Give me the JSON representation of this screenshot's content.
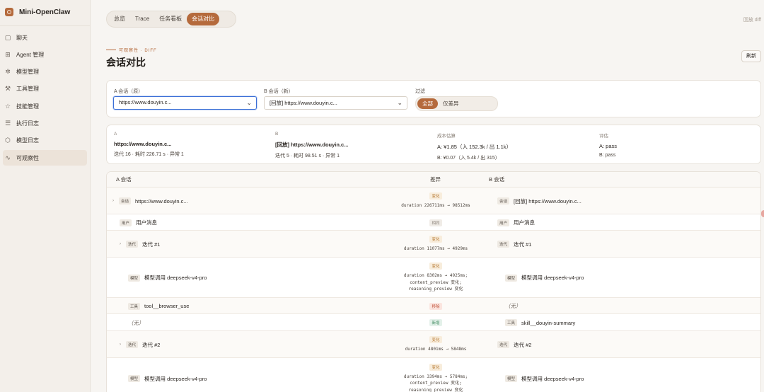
{
  "app": {
    "name": "Mini-OpenClaw",
    "logo_icon": "shield-logo-icon"
  },
  "sidebar": {
    "items": [
      {
        "label": "聊天",
        "icon": "chat-icon",
        "glyph": "▢"
      },
      {
        "label": "Agent 管理",
        "icon": "grid-icon",
        "glyph": "⊞"
      },
      {
        "label": "模型管理",
        "icon": "sparkle-icon",
        "glyph": "✲"
      },
      {
        "label": "工具管理",
        "icon": "wrench-icon",
        "glyph": "⚒"
      },
      {
        "label": "技能管理",
        "icon": "star-icon",
        "glyph": "☆"
      },
      {
        "label": "执行日志",
        "icon": "list-icon",
        "glyph": "☰"
      },
      {
        "label": "模型日志",
        "icon": "cube-icon",
        "glyph": "⬡"
      },
      {
        "label": "可观察性",
        "icon": "pulse-icon",
        "glyph": "∿"
      }
    ],
    "active_index": 7
  },
  "tabs": {
    "items": [
      "总览",
      "Trace",
      "任务看板",
      "会话对比"
    ],
    "active_index": 3
  },
  "breadcrumb": "回放 diff",
  "header": {
    "eyebrow": "可观察性 · DIFF",
    "title": "会话对比",
    "refresh_label": "刷新"
  },
  "filters": {
    "a_label": "A 会话（原）",
    "a_value": "https://www.douyin.c...",
    "b_label": "B 会话（新）",
    "b_value": "[回放] https://www.douyin.c...",
    "filter_label": "过滤",
    "options": [
      "全部",
      "仅差异"
    ],
    "active_option": 0
  },
  "summary": {
    "a": {
      "key": "A",
      "title": "https://www.douyin.c...",
      "stats": "迭代 16 · 耗时 226.71 s · 异常 1"
    },
    "b": {
      "key": "B",
      "title": "[回放] https://www.douyin.c...",
      "stats": "迭代 5 · 耗时 98.51 s · 异常 1"
    },
    "cost": {
      "key": "成本估算",
      "a": "A: ¥1.85（入 152.3k / 出 1.1k）",
      "b": "B: ¥0.07（入 5.4k / 出 315）"
    },
    "eval": {
      "key": "评估",
      "a": "A: pass",
      "b": "B: pass"
    }
  },
  "table": {
    "headers": {
      "a": "A 会话",
      "diff": "差异",
      "b": "B 会话"
    },
    "rows": [
      {
        "a_tag": "会话",
        "a_text": "https://www.douyin.c...",
        "badge": "变化",
        "badge_type": "chg",
        "lines": [
          "duration 226711ms → 98512ms"
        ],
        "b_tag": "会话",
        "b_text": "[回放] https://www.douyin.c..."
      },
      {
        "a_tag": "用户",
        "a_text": "用户消息",
        "badge": "相同",
        "badge_type": "same",
        "lines": [],
        "b_tag": "用户",
        "b_text": "用户消息"
      },
      {
        "a_tag": "迭代",
        "a_text": "迭代 #1",
        "badge": "变化",
        "badge_type": "chg",
        "lines": [
          "duration 11077ms → 4929ms"
        ],
        "b_tag": "迭代",
        "b_text": "迭代 #1"
      },
      {
        "a_tag": "模型",
        "a_text": "模型调用 deepseek-v4-pro",
        "badge": "变化",
        "badge_type": "chg",
        "lines": [
          "duration 8302ms → 4925ms;",
          "content_preview 变化;",
          "reasoning_preview 变化"
        ],
        "b_tag": "模型",
        "b_text": "模型调用 deepseek-v4-pro"
      },
      {
        "a_tag": "工具",
        "a_text": "tool__browser_use",
        "badge": "移除",
        "badge_type": "rm",
        "lines": [],
        "b_tag": "",
        "b_text": "（无）"
      },
      {
        "a_tag": "",
        "a_text": "（无）",
        "badge": "新增",
        "badge_type": "add",
        "lines": [],
        "b_tag": "工具",
        "b_text": "skill__douyin-summary"
      },
      {
        "a_tag": "迭代",
        "a_text": "迭代 #2",
        "badge": "变化",
        "badge_type": "chg",
        "lines": [
          "duration 4801ms → 5848ms"
        ],
        "b_tag": "迭代",
        "b_text": "迭代 #2"
      },
      {
        "a_tag": "模型",
        "a_text": "模型调用 deepseek-v4-pro",
        "badge": "变化",
        "badge_type": "chg",
        "lines": [
          "duration 3394ms → 5784ms;",
          "content_preview 变化;",
          "reasoning_preview 变化"
        ],
        "b_tag": "模型",
        "b_text": "模型调用 deepseek-v4-pro"
      }
    ]
  }
}
